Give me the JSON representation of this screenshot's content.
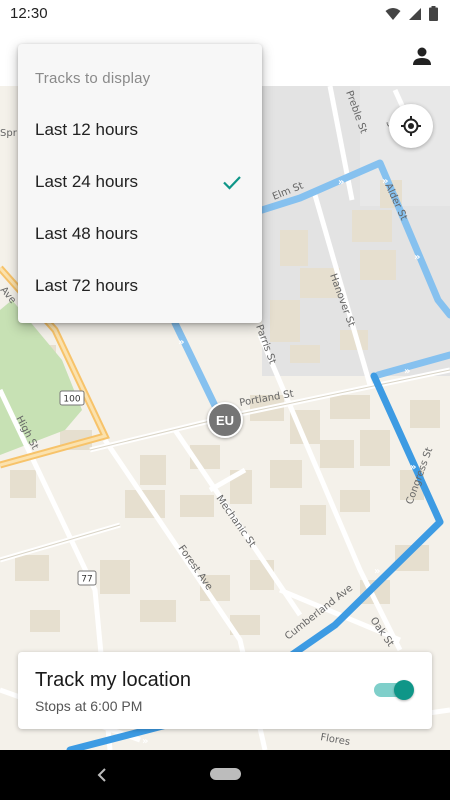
{
  "status_bar": {
    "time": "12:30",
    "icons": [
      "wifi-icon",
      "signal-icon",
      "battery-icon"
    ]
  },
  "app_bar": {
    "account_icon": "account-icon"
  },
  "map": {
    "locate_icon": "my-location-icon",
    "marker_label": "EU",
    "street_labels": {
      "high_st": "High St",
      "portland_st": "Portland St",
      "mechanic_st": "Mechanic St",
      "forest_ave": "Forest Ave",
      "hanover_st": "Hanover St",
      "parris_st": "Parris St",
      "oak_st": "Oak St",
      "cumberland_ave": "Cumberland Ave",
      "elm_st": "Elm St",
      "alder_st": "Alder St",
      "preble_st": "Preble St",
      "congress_st": "Congress St",
      "spring_st": "Spr",
      "st_top": "St",
      "ave_left": "Ave",
      "flores_st": "Flores"
    },
    "route_shields": [
      "100",
      "77"
    ],
    "colors": {
      "route_primary": "#3d9be3",
      "route_faded": "#86c1ef",
      "park": "#c7e1b4",
      "highway": "#f7c36a",
      "land": "#f4f1ea",
      "building": "#e7e1d2"
    }
  },
  "dropdown": {
    "header": "Tracks to display",
    "options": [
      {
        "label": "Last 12 hours",
        "selected": false
      },
      {
        "label": "Last 24 hours",
        "selected": true
      },
      {
        "label": "Last 48 hours",
        "selected": false
      },
      {
        "label": "Last 72 hours",
        "selected": false
      }
    ],
    "check_color": "#0f9688"
  },
  "track_card": {
    "title": "Track my location",
    "subtitle": "Stops at 6:00 PM",
    "toggle_on": true,
    "toggle_color": "#0f9688"
  },
  "nav_bar": {
    "back_icon": "back-icon",
    "home_icon": "home-pill-icon"
  }
}
